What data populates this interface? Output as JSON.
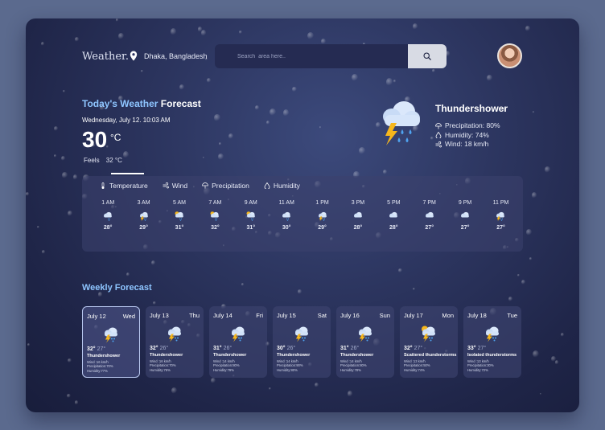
{
  "header": {
    "brand": "Weather.",
    "location": "Dhaka, Bangladesh",
    "search_placeholder": "Search  area here..",
    "search_icon": "search-icon",
    "avatar_icon": "user-avatar"
  },
  "today": {
    "title_highlight": "Today's Weather",
    "title_rest": "Forecast",
    "date": "Wednesday, July 12. 10:03 AM",
    "temp": "30",
    "unit": "°C",
    "feels_label": "Feels",
    "feels_value": "32 °C"
  },
  "current": {
    "condition": "Thundershower",
    "precipitation": "Precipitation: 80%",
    "humidity": "Humidity: 74%",
    "wind": "Wind: 18 km/h"
  },
  "tabs": [
    {
      "label": "Temperature",
      "icon": "thermometer-icon"
    },
    {
      "label": "Wind",
      "icon": "wind-icon"
    },
    {
      "label": "Precipitation",
      "icon": "umbrella-icon"
    },
    {
      "label": "Humidity",
      "icon": "droplet-icon"
    }
  ],
  "hourly": [
    {
      "time": "1 AM",
      "temp": "28°",
      "icon": "cloud-rain-icon"
    },
    {
      "time": "3 AM",
      "temp": "29°",
      "icon": "thunder-rain-icon"
    },
    {
      "time": "5 AM",
      "temp": "31°",
      "icon": "partly-cloudy-rain-icon"
    },
    {
      "time": "7 AM",
      "temp": "32°",
      "icon": "partly-cloudy-rain-icon"
    },
    {
      "time": "9 AM",
      "temp": "31°",
      "icon": "partly-cloudy-rain-icon"
    },
    {
      "time": "11 AM",
      "temp": "30°",
      "icon": "cloud-rain-icon"
    },
    {
      "time": "1 PM",
      "temp": "29°",
      "icon": "thunder-rain-icon"
    },
    {
      "time": "3 PM",
      "temp": "28°",
      "icon": "cloud-icon"
    },
    {
      "time": "5 PM",
      "temp": "28°",
      "icon": "cloud-icon"
    },
    {
      "time": "7 PM",
      "temp": "27°",
      "icon": "cloud-icon"
    },
    {
      "time": "9 PM",
      "temp": "27°",
      "icon": "cloud-icon"
    },
    {
      "time": "11 PM",
      "temp": "27°",
      "icon": "thunder-rain-icon"
    }
  ],
  "weekly_title": "Weekly Forecast",
  "weekly": [
    {
      "date": "July 12",
      "day": "Wed",
      "hi": "32°",
      "lo": "27°",
      "cond": "Thundershower",
      "wind": "Wind :16 km/h",
      "precip": "Precipitation:70%",
      "humid": "Humidity:77%",
      "icon": "thunder-rain-icon"
    },
    {
      "date": "July 13",
      "day": "Thu",
      "hi": "32°",
      "lo": "26°",
      "cond": "Thundershower",
      "wind": "Wind :16 km/h",
      "precip": "Precipitation:70%",
      "humid": "Humidity:76%",
      "icon": "thunder-rain-icon"
    },
    {
      "date": "July 14",
      "day": "Fri",
      "hi": "31°",
      "lo": "26°",
      "cond": "Thundershower",
      "wind": "Wind :14 km/h",
      "precip": "Precipitation:80%",
      "humid": "Humidity:79%",
      "icon": "thunder-rain-icon"
    },
    {
      "date": "July 15",
      "day": "Sat",
      "hi": "30°",
      "lo": "26°",
      "cond": "Thundershower",
      "wind": "Wind :14 km/h",
      "precip": "Precipitation:90%",
      "humid": "Humidity:80%",
      "icon": "thunder-rain-icon"
    },
    {
      "date": "July 16",
      "day": "Sun",
      "hi": "31°",
      "lo": "26°",
      "cond": "Thundershower",
      "wind": "Wind :14 km/h",
      "precip": "Precipitation:80%",
      "humid": "Humidity:78%",
      "icon": "thunder-rain-icon"
    },
    {
      "date": "July 17",
      "day": "Mon",
      "hi": "32°",
      "lo": "27°",
      "cond": "Scattered thunderstorms",
      "wind": "Wind :13 km/h",
      "precip": "Precipitation:50%",
      "humid": "Humidity:74%",
      "icon": "partly-cloudy-thunder-icon"
    },
    {
      "date": "July 18",
      "day": "Tue",
      "hi": "33°",
      "lo": "27°",
      "cond": "Isolated thunderstorms",
      "wind": "Wind :13 km/h",
      "precip": "Precipitation:30%",
      "humid": "Humidity:72%",
      "icon": "thunder-rain-icon"
    }
  ],
  "colors": {
    "page_bg": "#5b6a8e",
    "accent": "#8ec5ff",
    "cloud": "#dbe8fb",
    "bolt": "#f6b71c",
    "drop": "#4fa3f0"
  }
}
